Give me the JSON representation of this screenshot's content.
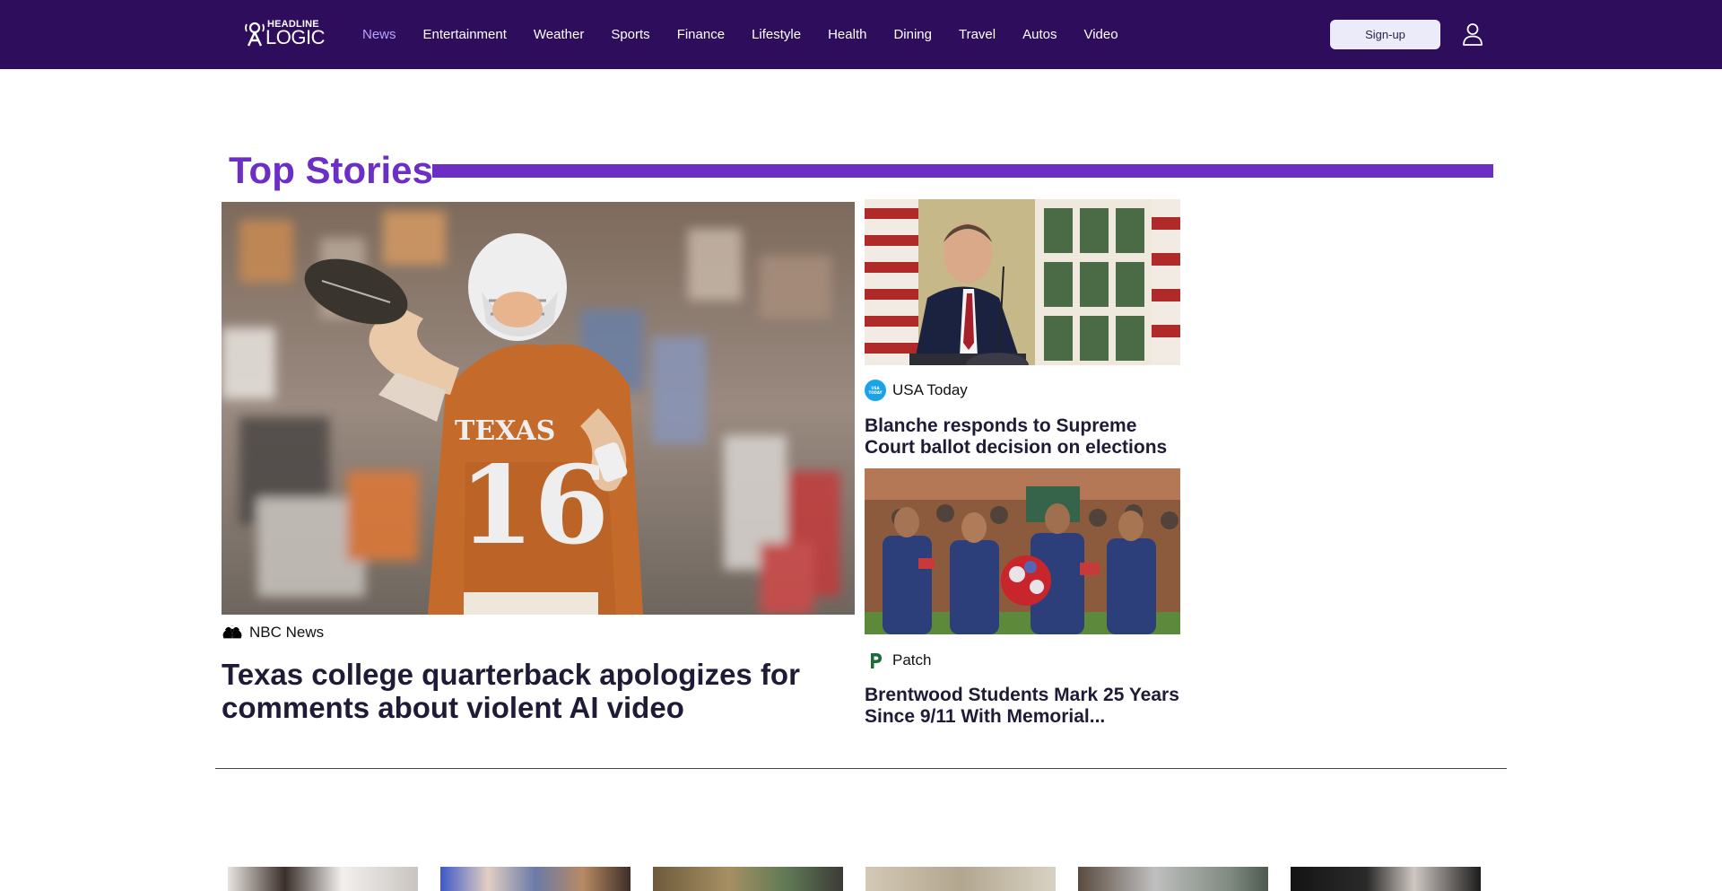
{
  "brand": {
    "logo_top": "HEADLINE",
    "logo_bottom": "LOGIC",
    "header_bg": "#2e0d5c",
    "accent": "#6b2fc5",
    "active_nav_color": "#b7a3ff"
  },
  "nav": {
    "items": [
      {
        "label": "News",
        "active": true
      },
      {
        "label": "Entertainment"
      },
      {
        "label": "Weather"
      },
      {
        "label": "Sports"
      },
      {
        "label": "Finance"
      },
      {
        "label": "Lifestyle"
      },
      {
        "label": "Health"
      },
      {
        "label": "Dining"
      },
      {
        "label": "Travel"
      },
      {
        "label": "Autos"
      },
      {
        "label": "Video"
      }
    ],
    "signup_label": "Sign-up",
    "user_icon": "user-icon"
  },
  "section": {
    "title": "Top Stories"
  },
  "main_story": {
    "source": "NBC News",
    "source_icon": "nbc-peacock-icon",
    "headline": "Texas college quarterback apologizes for comments about violent AI video",
    "jersey_text": "TEXAS",
    "jersey_number": "16"
  },
  "side_stories": [
    {
      "source": "USA Today",
      "source_icon": "usa-today-icon",
      "headline": "Blanche responds to Supreme Court ballot decision on elections"
    },
    {
      "source": "Patch",
      "source_icon": "patch-icon",
      "headline": "Brentwood Students Mark 25 Years Since 9/11 With Memorial..."
    }
  ]
}
